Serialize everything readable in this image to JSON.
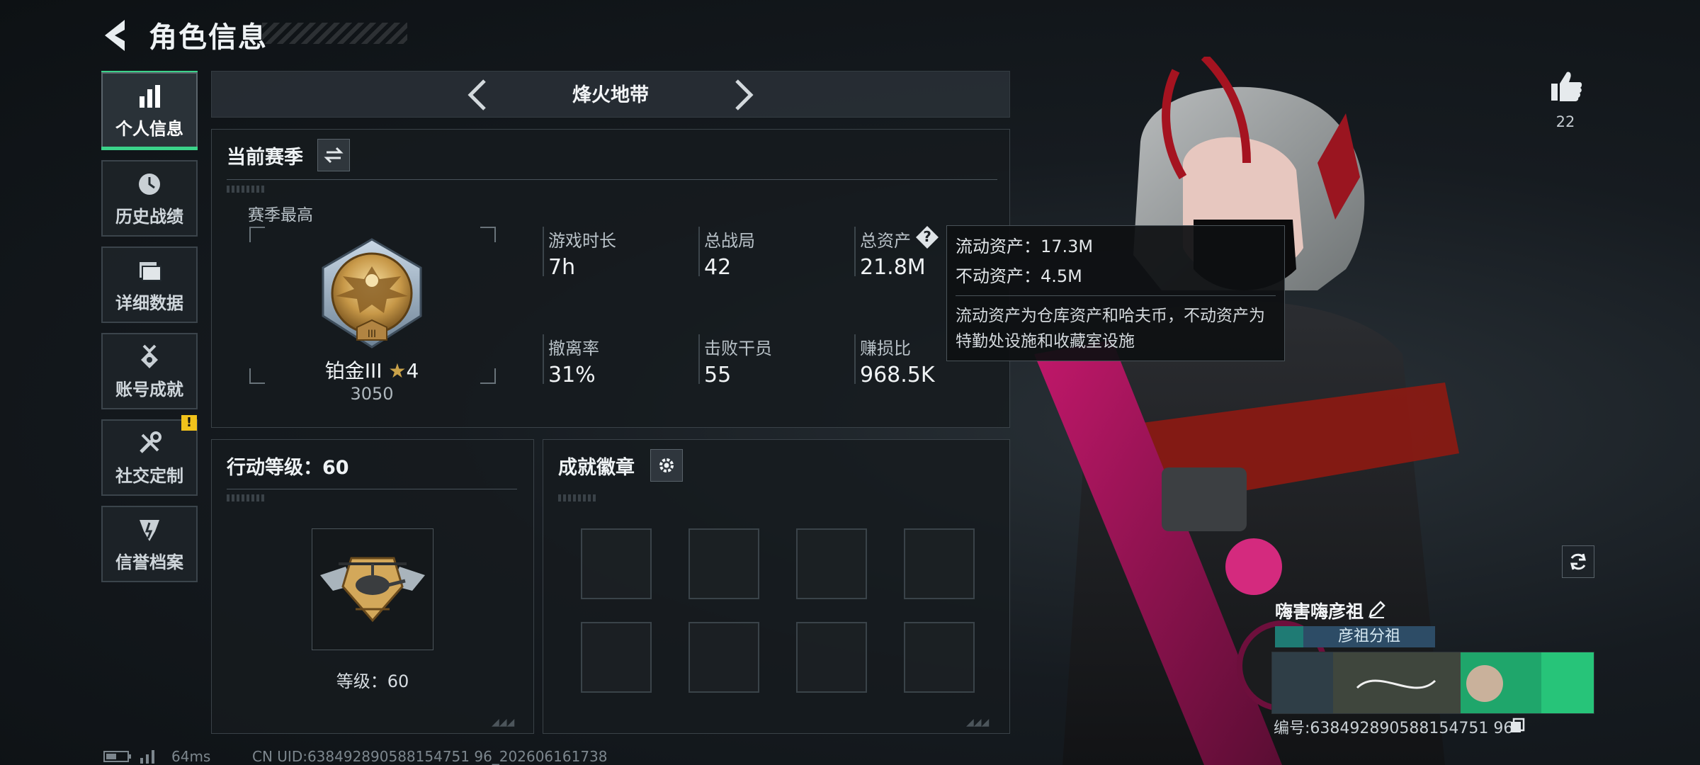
{
  "header": {
    "title": "角色信息"
  },
  "sidebar": {
    "items": [
      {
        "label": "个人信息",
        "icon": "bar-chart-icon",
        "active": true
      },
      {
        "label": "历史战绩",
        "icon": "clock-icon"
      },
      {
        "label": "详细数据",
        "icon": "folder-icon"
      },
      {
        "label": "账号成就",
        "icon": "medal-icon"
      },
      {
        "label": "社交定制",
        "icon": "tools-icon",
        "alert": "!"
      },
      {
        "label": "信誉档案",
        "icon": "badge-icon"
      }
    ]
  },
  "mode": {
    "name": "烽火地带"
  },
  "season": {
    "title": "当前赛季",
    "best_label": "赛季最高",
    "rank_name": "铂金III",
    "rank_stars": "4",
    "rank_points": "3050",
    "stats": [
      {
        "label": "游戏时长",
        "value": "7h"
      },
      {
        "label": "总战局",
        "value": "42"
      },
      {
        "label": "总资产",
        "value": "21.8M",
        "help": "?"
      },
      {
        "label": "撤离率",
        "value": "31%"
      },
      {
        "label": "击败干员",
        "value": "55"
      },
      {
        "label": "赚损比",
        "value": "968.5K"
      }
    ]
  },
  "tooltip": {
    "liquid": "流动资产：17.3M",
    "fixed": "不动资产：4.5M",
    "desc": "流动资产为仓库资产和哈夫币，不动资产为特勤处设施和收藏室设施"
  },
  "action_level": {
    "title": "行动等级：60",
    "level_text": "等级：60"
  },
  "badges": {
    "title": "成就徽章"
  },
  "social": {
    "like_count": "22"
  },
  "player": {
    "name": "嗨害嗨彦祖",
    "clan": "彦祖分祖",
    "id_text": "编号:638492890588154751 96"
  },
  "footer": {
    "ping": "64ms",
    "uid": "CN UID:638492890588154751 96_202606161738"
  },
  "colors": {
    "accent": "#3bd38a",
    "alert": "#f1c21b",
    "bg": "#161b20"
  }
}
